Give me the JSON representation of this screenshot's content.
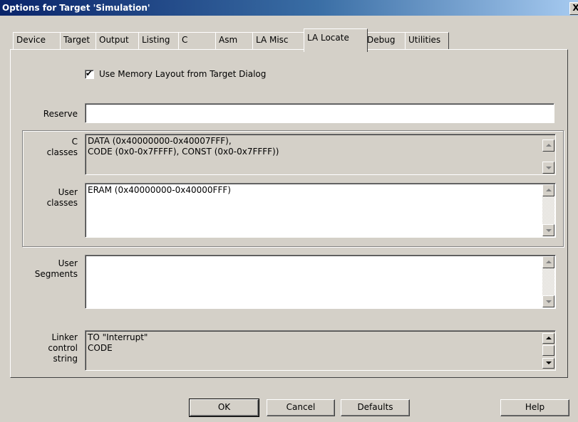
{
  "window": {
    "title": "Options for Target 'Simulation'",
    "close_glyph": "X"
  },
  "tabs": [
    {
      "label": "Device"
    },
    {
      "label": "Target"
    },
    {
      "label": "Output"
    },
    {
      "label": "Listing"
    },
    {
      "label": "C"
    },
    {
      "label": "Asm"
    },
    {
      "label": "LA Misc"
    },
    {
      "label": "LA Locate",
      "active": true
    },
    {
      "label": "Debug"
    },
    {
      "label": "Utilities"
    }
  ],
  "locate": {
    "use_memory_layout": {
      "label": "Use Memory Layout from Target Dialog",
      "checked": true,
      "mark": "✔"
    },
    "reserve": {
      "label": "Reserve",
      "value": ""
    },
    "c_classes": {
      "label": "C\nclasses",
      "value": "DATA (0x40000000-0x40007FFF),\nCODE (0x0-0x7FFFF), CONST (0x0-0x7FFFF))"
    },
    "user_classes": {
      "label": "User\nclasses",
      "value": "ERAM (0x40000000-0x40000FFF)"
    },
    "user_segments": {
      "label": "User\nSegments",
      "value": ""
    },
    "linker_control": {
      "label": "Linker\ncontrol\nstring",
      "value": "TO \"Interrupt\"\nCODE"
    }
  },
  "buttons": {
    "ok": "OK",
    "cancel": "Cancel",
    "defaults": "Defaults",
    "help": "Help"
  }
}
